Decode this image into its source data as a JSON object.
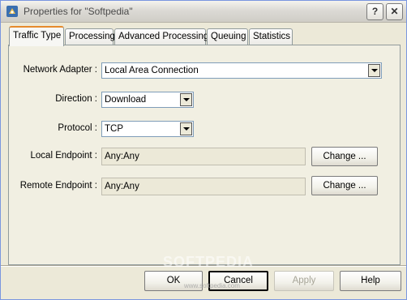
{
  "window": {
    "title": "Properties for \"Softpedia\"",
    "help_label": "?",
    "close_label": "✕"
  },
  "tabs": [
    {
      "label": "Traffic Type",
      "active": true
    },
    {
      "label": "Processing"
    },
    {
      "label": "Advanced Processing"
    },
    {
      "label": "Queuing"
    },
    {
      "label": "Statistics"
    }
  ],
  "form": {
    "network_adapter": {
      "label": "Network Adapter :",
      "value": "Local Area Connection"
    },
    "direction": {
      "label": "Direction :",
      "value": "Download"
    },
    "protocol": {
      "label": "Protocol :",
      "value": "TCP"
    },
    "local_endpoint": {
      "label": "Local Endpoint :",
      "value": "Any:Any",
      "button": "Change ..."
    },
    "remote_endpoint": {
      "label": "Remote Endpoint :",
      "value": "Any:Any",
      "button": "Change ..."
    }
  },
  "buttons": {
    "ok": "OK",
    "cancel": "Cancel",
    "apply": "Apply",
    "help": "Help"
  },
  "watermark": {
    "text": "SOFTPEDIA",
    "sub": "www.softpedia.com"
  }
}
